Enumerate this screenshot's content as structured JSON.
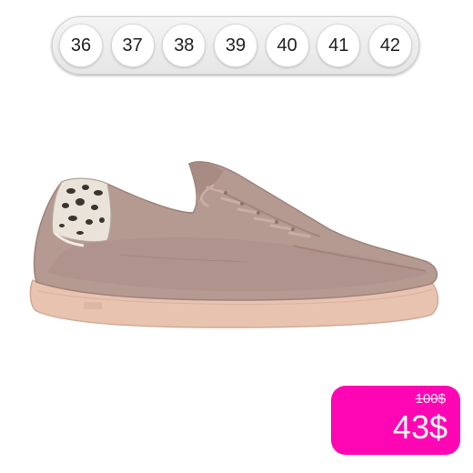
{
  "sizes": [
    "36",
    "37",
    "38",
    "39",
    "40",
    "41",
    "42"
  ],
  "product": {
    "image": "suede-sneaker-with-leopard-heel",
    "colors": {
      "suede": "#b59a92",
      "sole": "#e8c3b0",
      "leopard_base": "#e9e3da",
      "leopard_spots": "#3b332d"
    }
  },
  "price": {
    "old": "100$",
    "current": "43$",
    "badge_color": "#ff06b4"
  }
}
